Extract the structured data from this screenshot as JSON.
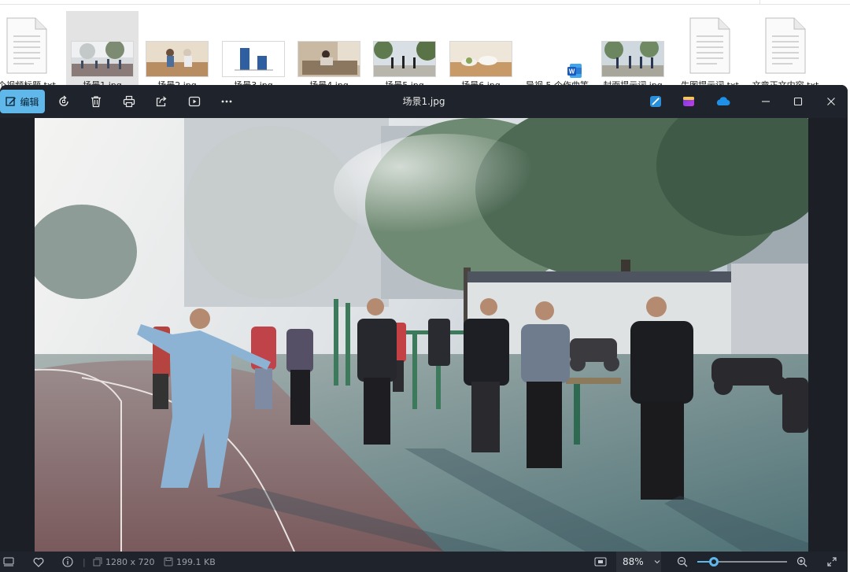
{
  "explorer": {
    "files": [
      {
        "name": "个视频标题.txt",
        "kind": "txt"
      },
      {
        "name": "场景1.jpg",
        "kind": "img-street",
        "selected": true
      },
      {
        "name": "场景2.jpg",
        "kind": "img-room"
      },
      {
        "name": "场景3.jpg",
        "kind": "img-chart"
      },
      {
        "name": "场景4.jpg",
        "kind": "img-sofa"
      },
      {
        "name": "场景5.jpg",
        "kind": "img-park"
      },
      {
        "name": "场景6.jpg",
        "kind": "img-table"
      },
      {
        "name": "导视 5 个作曲等",
        "kind": "word"
      },
      {
        "name": "封面提示词.jpg",
        "kind": "img-park2"
      },
      {
        "name": "生图提示词.txt",
        "kind": "txt"
      },
      {
        "name": "文章正文内容.txt",
        "kind": "txt"
      }
    ]
  },
  "viewer": {
    "title": "场景1.jpg",
    "edit_label": "编辑",
    "toolbar_icons": [
      "edit-icon",
      "rotate-icon",
      "delete-icon",
      "print-icon",
      "share-icon",
      "slideshow-icon",
      "more-icon"
    ],
    "right_icons": [
      "magic-edit-icon",
      "clipchamp-icon",
      "onedrive-icon"
    ],
    "window_controls": [
      "minimize-icon",
      "maximize-icon",
      "close-icon"
    ]
  },
  "status": {
    "dimensions": "1280 x 720",
    "file_size": "199.1 KB",
    "zoom": "88%",
    "zoom_fraction": 0.18
  },
  "colors": {
    "accent": "#5fb7ea",
    "window_bg": "#1c1f26"
  }
}
